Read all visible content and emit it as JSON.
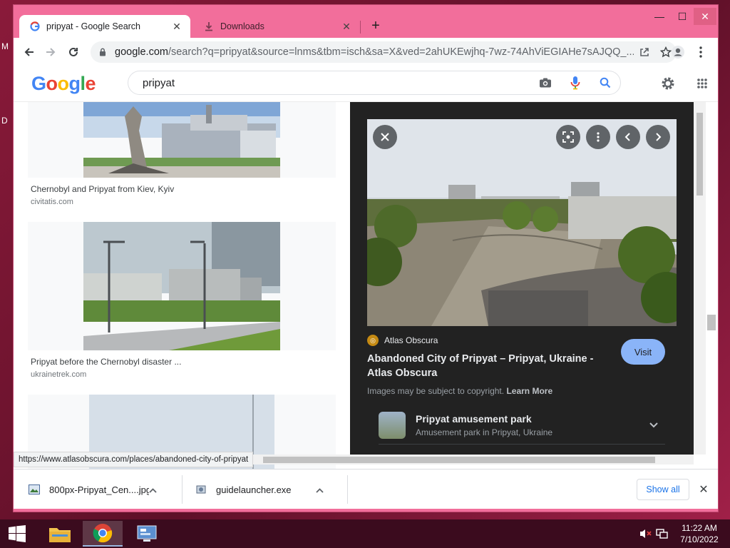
{
  "tabs": [
    {
      "title": "pripyat - Google Search",
      "favicon": "google-g-icon",
      "active": true
    },
    {
      "title": "Downloads",
      "favicon": "download-icon",
      "active": false
    }
  ],
  "window_controls": {
    "minimize": "—",
    "maximize": "☐",
    "close": "✕"
  },
  "toolbar": {
    "url_host": "google.com",
    "url_path": "/search?q=pripyat&source=lnms&tbm=isch&sa=X&ved=2ahUKEwjhq-7wz-74AhViEGIAHe7sAJQQ_..."
  },
  "google": {
    "logo": "Google",
    "logo_colors": [
      "#4285f4",
      "#ea4335",
      "#fbbc05",
      "#4285f4",
      "#34a853",
      "#ea4335"
    ],
    "search_value": "pripyat"
  },
  "results": [
    {
      "title": "Chernobyl and Pripyat from Kiev, Kyiv",
      "source": "civitatis.com"
    },
    {
      "title": "Pripyat before the Chernobyl disaster ...",
      "source": "ukrainetrek.com"
    }
  ],
  "viewer": {
    "source_name": "Atlas Obscura",
    "title": "Abandoned City of Pripyat – Pripyat, Ukraine - Atlas Obscura",
    "visit_label": "Visit",
    "copyright_text": "Images may be subject to copyright.",
    "learn_more": "Learn More",
    "related": {
      "title": "Pripyat amusement park",
      "subtitle": "Amusement park in Pripyat, Ukraine"
    }
  },
  "status_url": "https://www.atlasobscura.com/places/abandoned-city-of-pripyat",
  "downloads": {
    "items": [
      {
        "name": "800px-Pripyat_Cen....jpg",
        "icon": "image-file-icon"
      },
      {
        "name": "guidelauncher.exe",
        "icon": "exe-file-icon"
      }
    ],
    "show_all": "Show all"
  },
  "taskbar": {
    "time": "11:22 AM",
    "date": "7/10/2022"
  },
  "desktop_hints": [
    "M",
    "D"
  ],
  "colors": {
    "accent": "#1a73e8",
    "chrome_frame": "#f26e9b",
    "viewer_bg": "#222222",
    "visit_button": "#8ab4f8"
  }
}
